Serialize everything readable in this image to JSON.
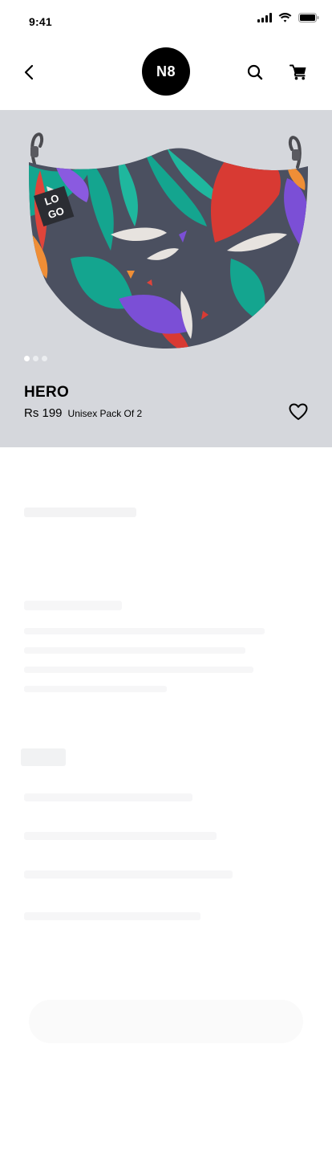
{
  "status_bar": {
    "time": "9:41",
    "icons": [
      "signal-icon",
      "wifi-icon",
      "battery-icon"
    ]
  },
  "header": {
    "logo_text": "N8",
    "icons": [
      "chevron-left-icon",
      "search-icon",
      "cart-icon"
    ]
  },
  "product": {
    "name": "HERO",
    "price": "Rs 199",
    "pack": "Unisex Pack Of 2",
    "image_logo_text": "LOGO",
    "gallery": {
      "total": 3,
      "active_index": 0
    },
    "wishlist_icon": "heart-outline-icon"
  },
  "colors": {
    "hero_background": "#d5d7dc",
    "mask_base": "#4b5060",
    "mask_teal": "#14a58f",
    "mask_red": "#d83a33",
    "mask_purple": "#7b4fd6",
    "mask_orange": "#ef8e36",
    "logo_background": "#000000"
  }
}
